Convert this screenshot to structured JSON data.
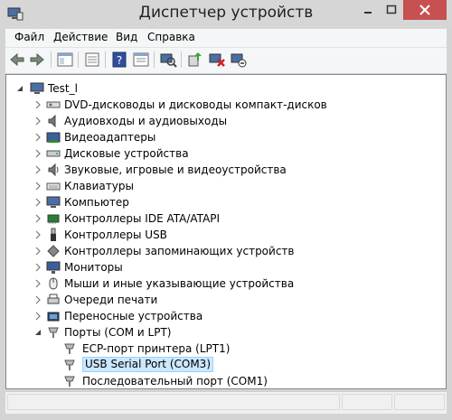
{
  "window": {
    "title": "Диспетчер устройств",
    "accent": "#d4d4d4",
    "close_color": "#c75050"
  },
  "menu": [
    "Файл",
    "Действие",
    "Вид",
    "Справка"
  ],
  "toolbar": [
    "back-icon",
    "forward-icon",
    "properties-panel-icon",
    "show-hidden-icon",
    "help-icon",
    "properties-icon",
    "scan-hardware-icon",
    "update-driver-icon",
    "disable-device-icon",
    "uninstall-device-icon"
  ],
  "tree": {
    "root": "Test_l",
    "categories": [
      "DVD-дисководы и дисководы компакт-дисков",
      "Аудиовходы и аудиовыходы",
      "Видеоадаптеры",
      "Дисковые устройства",
      "Звуковые, игровые и видеоустройства",
      "Клавиатуры",
      "Компьютер",
      "Контроллеры IDE ATA/ATAPI",
      "Контроллеры USB",
      "Контроллеры запоминающих устройств",
      "Мониторы",
      "Мыши и иные указывающие устройства",
      "Очереди печати",
      "Переносные устройства",
      "Порты (COM и LPT)"
    ],
    "ports_children": [
      "ECP-порт принтера (LPT1)",
      "USB Serial Port (COM3)",
      "Последовательный порт (COM1)"
    ],
    "selected": "USB Serial Port (COM3)"
  }
}
